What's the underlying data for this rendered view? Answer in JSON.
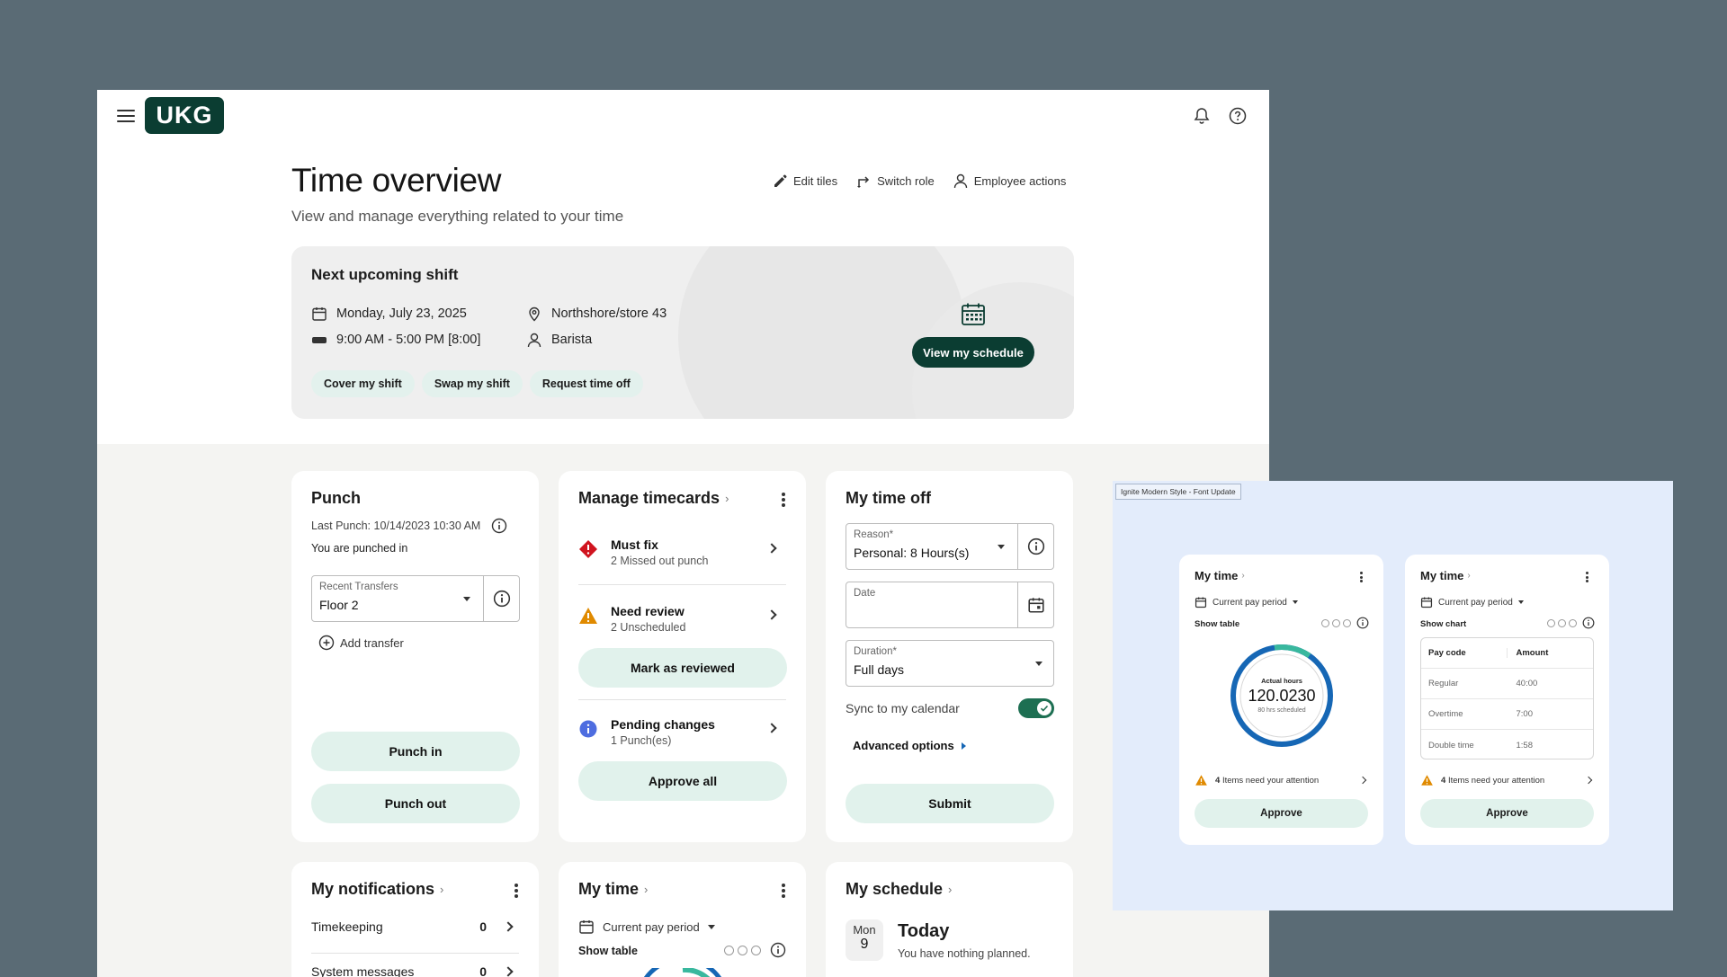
{
  "app": {
    "logo_text": "UKG",
    "title": "Time overview",
    "subtitle": "View and manage everything related to your time",
    "actions": [
      "Edit tiles",
      "Switch role",
      "Employee actions"
    ]
  },
  "shift": {
    "title": "Next upcoming shift",
    "date": "Monday, July 23, 2025",
    "time": "9:00 AM - 5:00 PM [8:00]",
    "location": "Northshore/store 43",
    "role": "Barista",
    "chips": [
      "Cover my shift",
      "Swap my shift",
      "Request time off"
    ],
    "view_button": "View my schedule"
  },
  "punch": {
    "title": "Punch",
    "last_punch": "Last Punch: 10/14/2023 10:30 AM",
    "status": "You are punched in",
    "transfers_label": "Recent Transfers",
    "transfers_value": "Floor 2",
    "add_transfer": "Add transfer",
    "punch_in": "Punch in",
    "punch_out": "Punch out"
  },
  "timecards": {
    "title": "Manage timecards",
    "items": [
      {
        "name": "Must fix",
        "sub": "2 Missed out punch"
      },
      {
        "name": "Need review",
        "sub": "2 Unscheduled"
      },
      {
        "name": "Pending changes",
        "sub": "1 Punch(es)"
      }
    ],
    "mark_reviewed": "Mark as reviewed",
    "approve_all": "Approve all"
  },
  "timeoff": {
    "title": "My time off",
    "reason_label": "Reason*",
    "reason_value": "Personal: 8 Hours(s)",
    "date_label": "Date",
    "duration_label": "Duration*",
    "duration_value": "Full days",
    "sync_label": "Sync to my calendar",
    "sync_on": true,
    "advanced": "Advanced options",
    "submit": "Submit"
  },
  "notifications": {
    "title": "My notifications",
    "items": [
      {
        "label": "Timekeeping",
        "count": "0"
      },
      {
        "label": "System messages",
        "count": "0"
      }
    ]
  },
  "mytime": {
    "title": "My time",
    "period": "Current pay period",
    "show_table": "Show table"
  },
  "schedule": {
    "title": "My schedule",
    "day": "Mon",
    "date": "9",
    "today": "Today",
    "nothing": "You have nothing planned."
  },
  "preview": {
    "tag": "Ignite Modern Style - Font Update",
    "card1": {
      "title": "My time",
      "period": "Current pay period",
      "toggle": "Show table",
      "ring_label": "Actual hours",
      "ring_value": "120.0230",
      "ring_sub": "80 hrs scheduled",
      "ring_progress": 0.12,
      "alert_count": "4",
      "alert_text": "Items need your attention",
      "approve": "Approve"
    },
    "card2": {
      "title": "My time",
      "period": "Current pay period",
      "toggle": "Show chart",
      "table_headers": [
        "Pay code",
        "Amount"
      ],
      "rows": [
        {
          "code": "Regular",
          "amount": "40:00"
        },
        {
          "code": "Overtime",
          "amount": "7:00"
        },
        {
          "code": "Double time",
          "amount": "1:58"
        }
      ],
      "alert_count": "4",
      "alert_text": "Items need your attention",
      "approve": "Approve"
    }
  },
  "colors": {
    "brand": "#0b3d32",
    "mint": "#e1f2ec",
    "toggle": "#1d6f52",
    "ring_blue": "#1667b5",
    "ring_teal": "#39b89e",
    "warning": "#e08a00",
    "danger": "#d0141f",
    "info": "#4e6de0"
  }
}
